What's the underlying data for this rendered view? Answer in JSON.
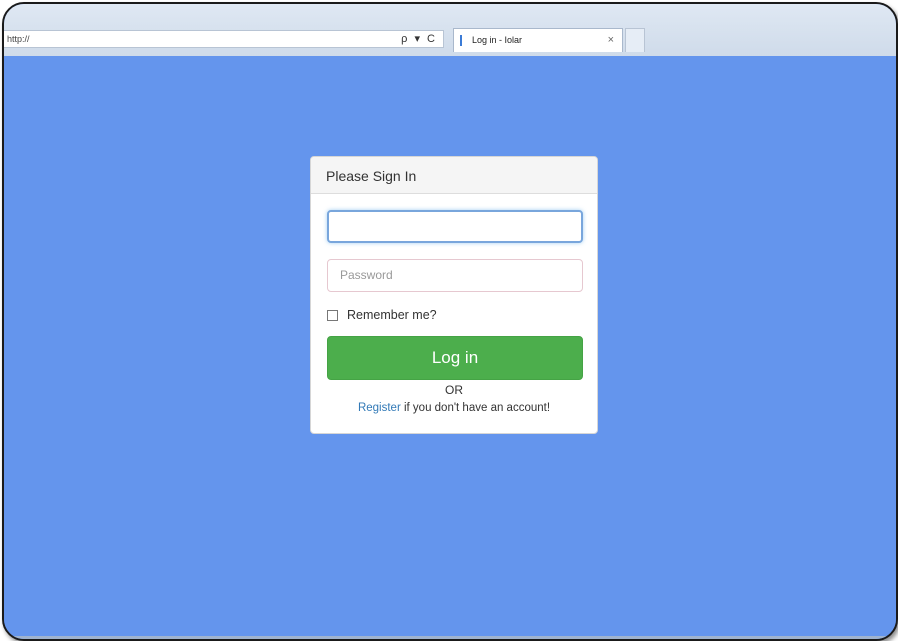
{
  "browser": {
    "address": "http://",
    "controls": "ρ ▾ C",
    "tab_title": "Log in - Iolar",
    "tab_close": "×"
  },
  "login": {
    "heading": "Please Sign In",
    "username_value": "",
    "password_placeholder": "Password",
    "remember_label": "Remember me?",
    "remember_checked": false,
    "login_button": "Log in",
    "or_text": "OR",
    "register_link": "Register",
    "register_suffix": " if you don't have an account!"
  },
  "colors": {
    "page_background": "#6495ed",
    "login_button": "#4cae4c",
    "link": "#337ab7"
  }
}
